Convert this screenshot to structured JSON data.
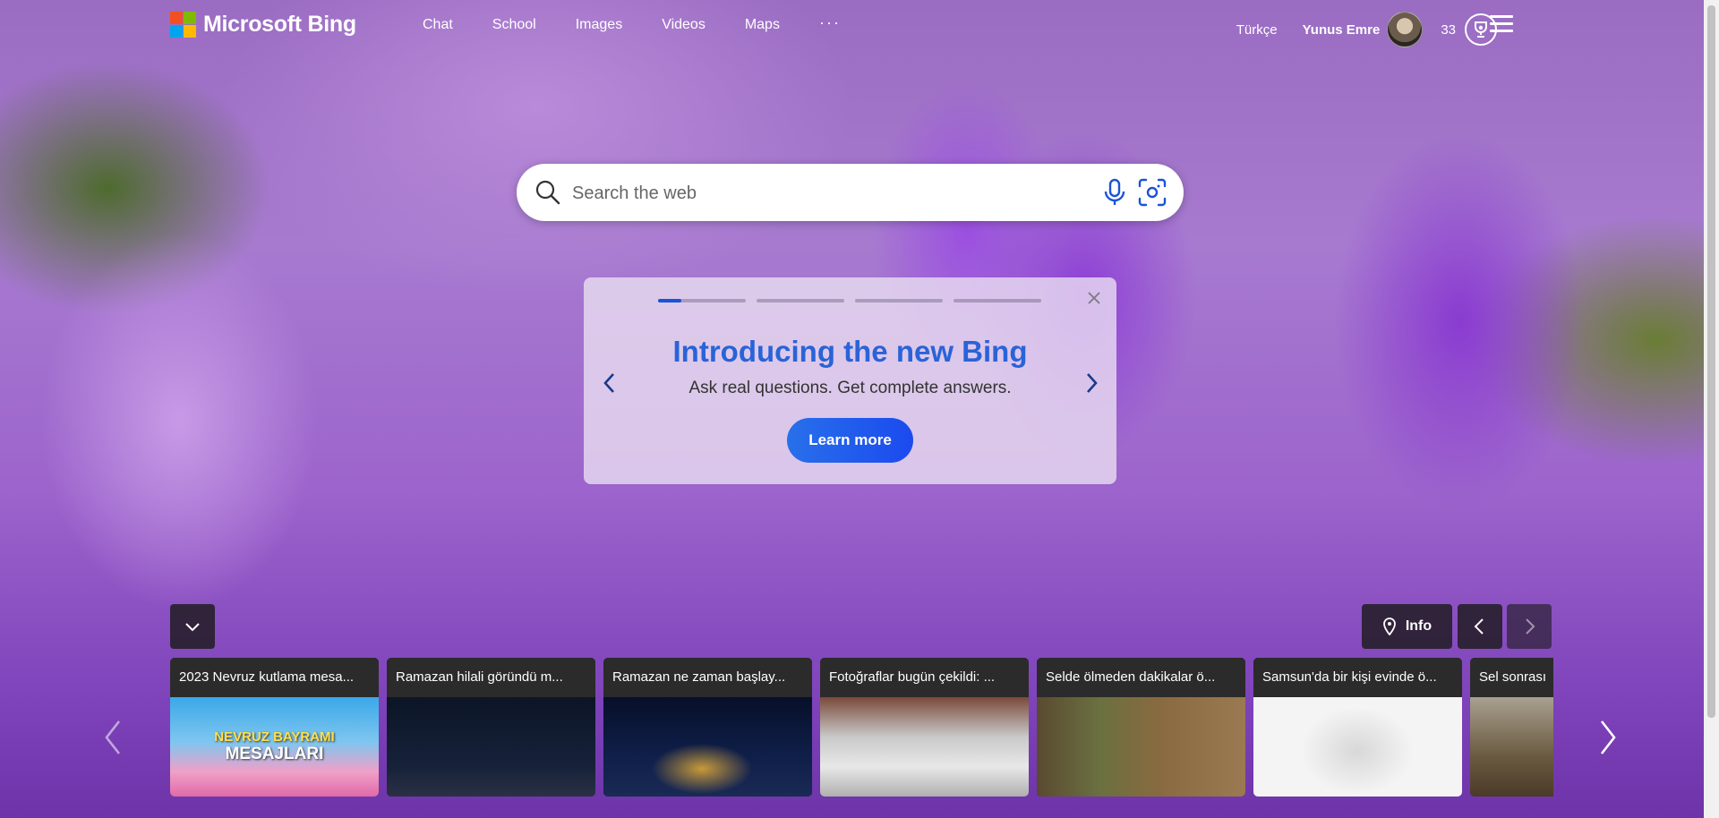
{
  "header": {
    "brand": "Microsoft Bing",
    "nav": [
      "Chat",
      "School",
      "Images",
      "Videos",
      "Maps"
    ],
    "more_label": "···",
    "language": "Türkçe",
    "user_name": "Yunus Emre",
    "reward_points": "33"
  },
  "search": {
    "placeholder": "Search the web"
  },
  "promo": {
    "title": "Introducing the new Bing",
    "subtitle": "Ask real questions. Get complete answers.",
    "button_label": "Learn more",
    "slides_total": 4,
    "active_slide": 1
  },
  "controls": {
    "info_label": "Info"
  },
  "news": [
    {
      "title": "2023 Nevruz kutlama mesa...",
      "image_text_1": "NEVRUZ BAYRAMI",
      "image_text_2": "MESAJLARI"
    },
    {
      "title": "Ramazan hilali göründü m..."
    },
    {
      "title": "Ramazan ne zaman başlay..."
    },
    {
      "title": "Fotoğraflar bugün çekildi: ..."
    },
    {
      "title": "Selde ölmeden dakikalar ö..."
    },
    {
      "title": "Samsun'da bir kişi evinde ö..."
    },
    {
      "title": "Sel sonrası"
    }
  ],
  "colors": {
    "accent": "#1b4aef",
    "promo_title": "#2a63d8",
    "ms_red": "#f25022",
    "ms_green": "#7fba00",
    "ms_blue": "#00a4ef",
    "ms_yellow": "#ffb900"
  }
}
